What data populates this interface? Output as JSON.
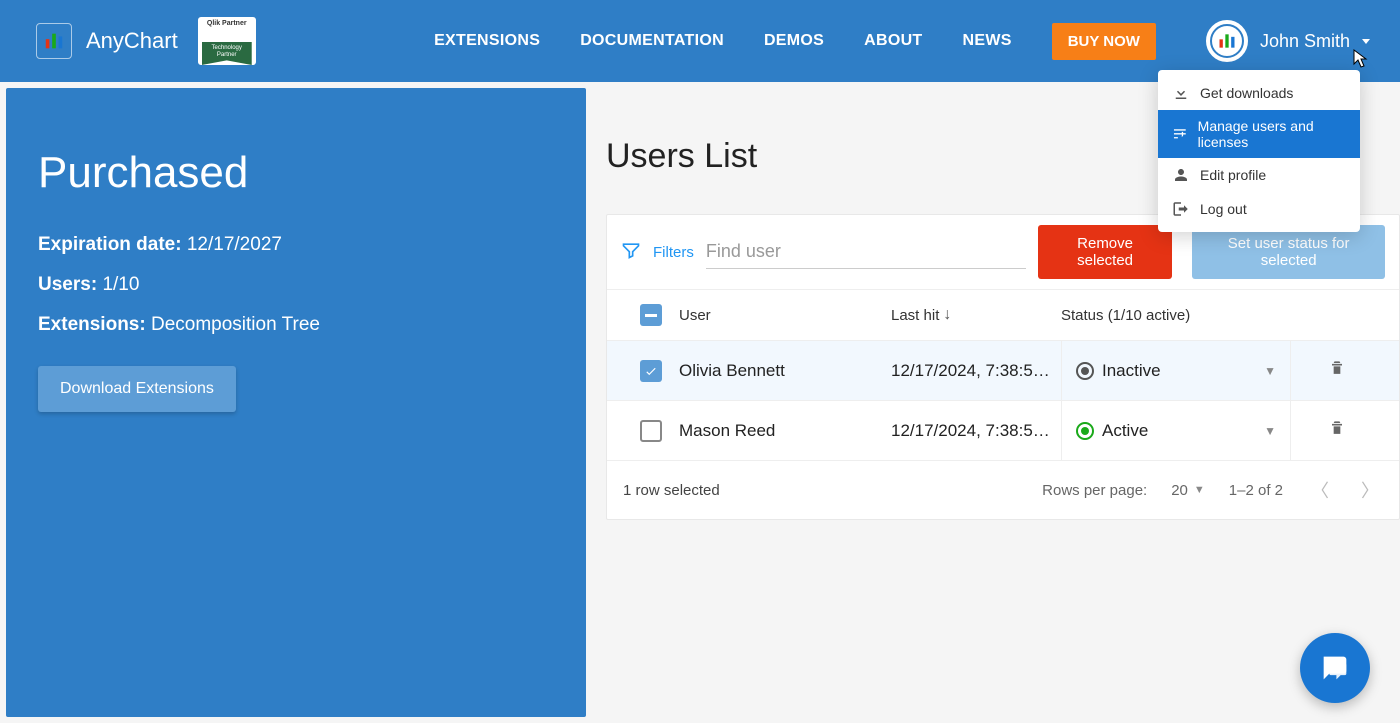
{
  "header": {
    "brand": "AnyChart",
    "partner_top": "Qlik Partner",
    "partner_ribbon": "Technology\nPartner",
    "nav": {
      "extensions": "EXTENSIONS",
      "documentation": "DOCUMENTATION",
      "demos": "DEMOS",
      "about": "ABOUT",
      "news": "NEWS"
    },
    "buy_now": "BUY NOW",
    "user_name": "John Smith"
  },
  "dropdown": {
    "get_downloads": "Get downloads",
    "manage": "Manage users and licenses",
    "edit_profile": "Edit profile",
    "logout": "Log out"
  },
  "sidebar": {
    "title": "Purchased",
    "exp_label": "Expiration date:",
    "exp_value": "12/17/2027",
    "users_label": "Users:",
    "users_value": "1/10",
    "ext_label": "Extensions:",
    "ext_value": "Decomposition Tree",
    "download_btn": "Download Extensions"
  },
  "main": {
    "title": "Users List",
    "filters_label": "Filters",
    "find_placeholder": "Find user",
    "remove_btn": "Remove selected",
    "set_status_btn": "Set user status for selected",
    "cols": {
      "user": "User",
      "last_hit": "Last hit",
      "status": "Status (1/10 active)"
    },
    "rows": [
      {
        "name": "Olivia Bennett",
        "last_hit": "12/17/2024, 7:38:5…",
        "status": "Inactive",
        "status_class": "inactive",
        "checked": true
      },
      {
        "name": "Mason Reed",
        "last_hit": "12/17/2024, 7:38:5…",
        "status": "Active",
        "status_class": "active",
        "checked": false
      }
    ],
    "pager": {
      "selected": "1 row selected",
      "rpp_label": "Rows per page:",
      "rpp_value": "20",
      "range": "1–2 of 2"
    }
  }
}
